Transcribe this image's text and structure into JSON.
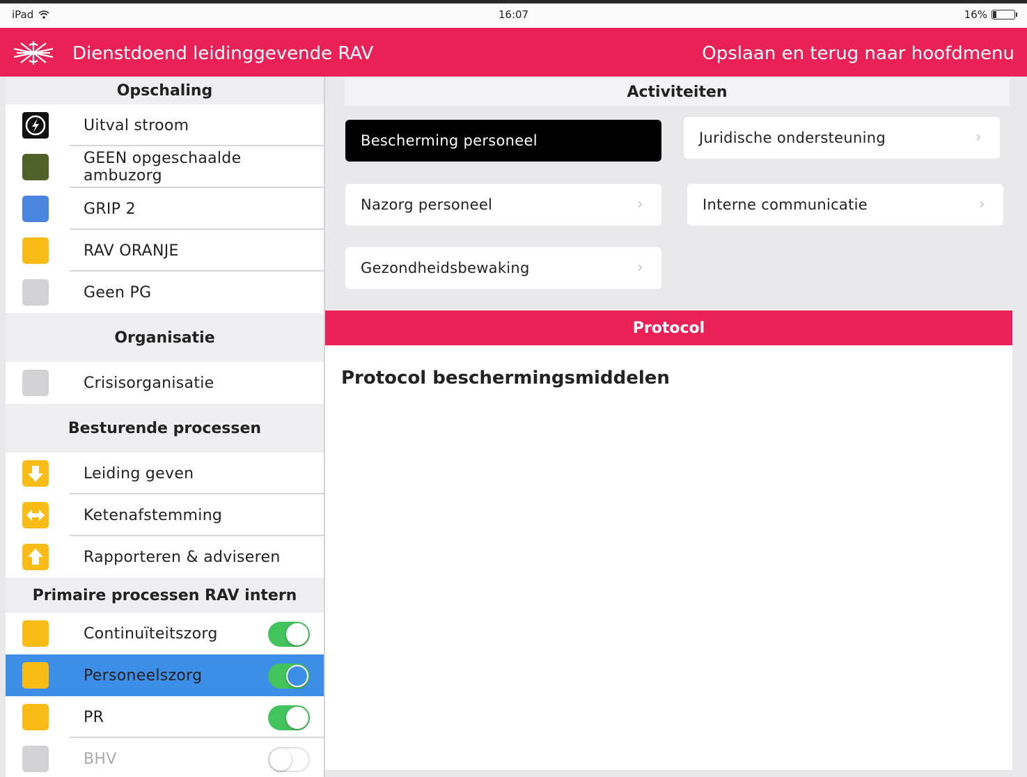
{
  "statusbar": {
    "device": "iPad",
    "time": "16:07",
    "battery": "16%",
    "battery_level": 0.16
  },
  "navbar": {
    "title": "Dienstdoend leidinggevende RAV",
    "back_label": "Opslaan en terug naar hoofdmenu",
    "color": "#ea2157"
  },
  "sidebar": {
    "sections": [
      {
        "title": "Opschaling",
        "items": [
          {
            "label": "Uitval stroom",
            "icon": "power-outage-icon"
          },
          {
            "label": "GEEN opgeschaalde ambuzorg",
            "color": "#4d6128"
          },
          {
            "label": "GRIP 2",
            "color": "#4a86e0"
          },
          {
            "label": "RAV ORANJE",
            "color": "#f9bc16"
          },
          {
            "label": "Geen PG",
            "color": "#d2d2d4"
          }
        ]
      },
      {
        "title": "Organisatie",
        "items": [
          {
            "label": "Crisisorganisatie",
            "color": "#d2d2d4"
          }
        ]
      },
      {
        "title": "Besturende processen",
        "items": [
          {
            "label": "Leiding geven",
            "icon": "arrow-down-icon",
            "color": "#f9bc16"
          },
          {
            "label": "Ketenafstemming",
            "icon": "arrows-horizontal-icon",
            "color": "#f9bc16"
          },
          {
            "label": "Rapporteren & adviseren",
            "icon": "arrow-up-icon",
            "color": "#f9bc16"
          }
        ]
      },
      {
        "title": "Primaire processen RAV intern",
        "items": [
          {
            "label": "Continuïteitszorg",
            "color": "#f9bc16",
            "toggle": true
          },
          {
            "label": "Personeelszorg",
            "color": "#f9bc16",
            "toggle": true,
            "selected": true
          },
          {
            "label": "PR",
            "color": "#f9bc16",
            "toggle": true
          },
          {
            "label": "BHV",
            "color": "#d2d2d4",
            "toggle": false
          }
        ]
      }
    ]
  },
  "activities": {
    "title": "Activiteiten",
    "items": [
      {
        "label": "Bescherming personeel",
        "selected": true
      },
      {
        "label": "Juridische ondersteuning"
      },
      {
        "label": "Nazorg personeel"
      },
      {
        "label": "Interne communicatie"
      },
      {
        "label": "Gezondheidsbewaking"
      }
    ]
  },
  "protocol": {
    "header": "Protocol",
    "title": "Protocol beschermingsmiddelen"
  }
}
